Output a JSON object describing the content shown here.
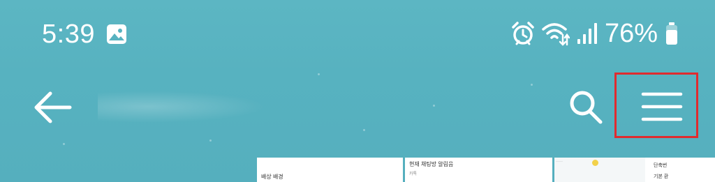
{
  "status_bar": {
    "time": "5:39",
    "battery_percent": "76%",
    "icons": [
      "gallery-icon",
      "alarm-icon",
      "wifi-icon",
      "signal-icon",
      "battery-icon"
    ]
  },
  "toolbar": {
    "back_icon": "arrow-left-icon",
    "search_icon": "search-icon",
    "menu_icon": "hamburger-menu-icon",
    "highlight_color": "#e02b2f"
  },
  "thumbnails": [
    {
      "line1": "배상 배경",
      "line2": ""
    },
    {
      "line1": "현재 채팅방 알림음",
      "line2": "카톡"
    },
    {
      "line1": "단축번",
      "line2": "기본 환"
    }
  ],
  "colors": {
    "background": "#57b2c0",
    "foreground": "#ffffff"
  }
}
